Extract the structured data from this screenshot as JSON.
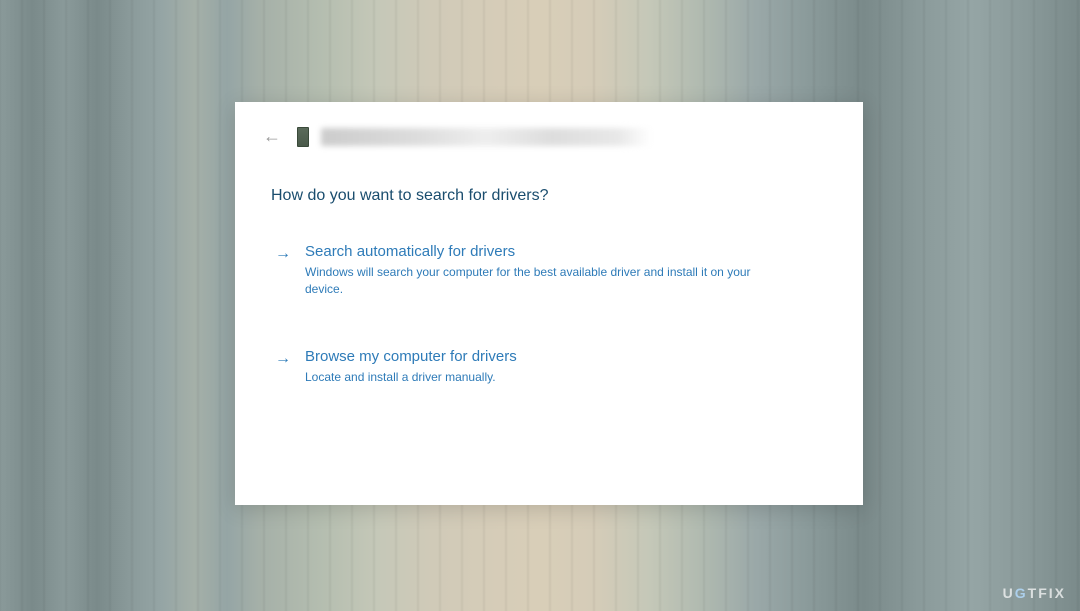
{
  "dialog": {
    "title": "How do you want to search for drivers?",
    "options": [
      {
        "title": "Search automatically for drivers",
        "description": "Windows will search your computer for the best available driver and install it on your device."
      },
      {
        "title": "Browse my computer for drivers",
        "description": "Locate and install a driver manually."
      }
    ]
  },
  "watermark": {
    "prefix": "U",
    "accent": "G",
    "suffix": "TFIX"
  }
}
